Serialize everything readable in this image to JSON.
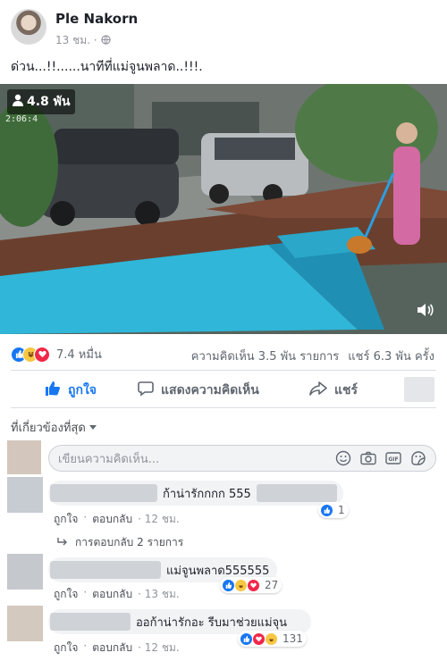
{
  "post": {
    "author": "Ple Nakorn",
    "time": "13 ชม. ·",
    "text": "ด่วน...!!......นาทีที่แม่จูนพลาด..!!!."
  },
  "video": {
    "views": "4.8 พัน",
    "timestamp": "2:06:4"
  },
  "reactions": {
    "count": "7.4 หมื่น",
    "comments": "ความคิดเห็น 3.5 พัน รายการ",
    "shares": "แชร์ 6.3 พัน ครั้ง"
  },
  "actions": {
    "like": "ถูกใจ",
    "comment": "แสดงความคิดเห็น",
    "share": "แชร์"
  },
  "sort": {
    "label": "ที่เกี่ยวข้องที่สุด"
  },
  "composer": {
    "placeholder": "เขียนความคิดเห็น..."
  },
  "comments": [
    {
      "text": "ก้าน่ารักกกก 555",
      "like": "ถูกใจ",
      "reply": "ตอบกลับ",
      "time": "· 12 ชม.",
      "reaction_count": "1"
    },
    {
      "text": "แม่จูนพลาด555555",
      "like": "ถูกใจ",
      "reply": "ตอบกลับ",
      "time": "· 13 ชม.",
      "reaction_count": "27"
    },
    {
      "text": "ออก้าน่ารักอะ รีบมาช่วยแม่จุน",
      "like": "ถูกใจ",
      "reply": "ตอบกลับ",
      "time": "· 12 ชม.",
      "reaction_count": "131"
    }
  ],
  "replies": {
    "label": "การตอบกลับ 2 รายการ"
  },
  "colors": {
    "facebook_blue": "#1877f2",
    "text_gray": "#606770",
    "pool": "#2fb6d8"
  }
}
